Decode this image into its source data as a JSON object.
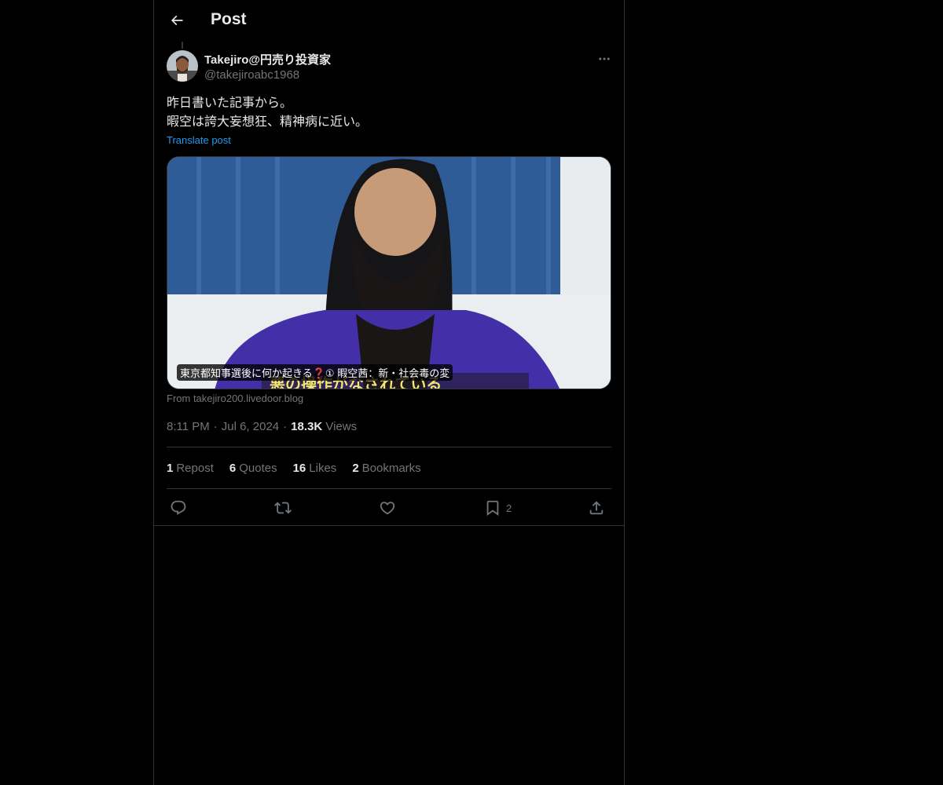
{
  "header": {
    "title": "Post"
  },
  "author": {
    "name": "Takejiro@円売り投資家",
    "handle": "@takejiroabc1968"
  },
  "post": {
    "lines": [
      "昨日書いた記事から。",
      "暇空は誇大妄想狂、精神病に近い。"
    ],
    "translate_label": "Translate post",
    "media_caption": "東京都知事選後に何か起きる❓① 暇空茜：新・社会毒の変",
    "media_subtitle": "悪の操作がなされている",
    "source": "From takejiro200.livedoor.blog"
  },
  "meta": {
    "time": "8:11 PM",
    "date": "Jul 6, 2024",
    "views_count": "18.3K",
    "views_label": "Views"
  },
  "stats": {
    "reposts": {
      "count": "1",
      "label": "Repost"
    },
    "quotes": {
      "count": "6",
      "label": "Quotes"
    },
    "likes": {
      "count": "16",
      "label": "Likes"
    },
    "bookmarks": {
      "count": "2",
      "label": "Bookmarks"
    }
  },
  "actions": {
    "bookmark_count": "2"
  },
  "icons": [
    "back-arrow-icon",
    "more-icon",
    "reply-icon",
    "repost-icon",
    "like-icon",
    "bookmark-icon",
    "share-icon"
  ],
  "colors": {
    "background": "#000000",
    "text": "#e7e9ea",
    "muted": "#71767b",
    "link": "#1d9bf0",
    "border": "#2f3336"
  }
}
